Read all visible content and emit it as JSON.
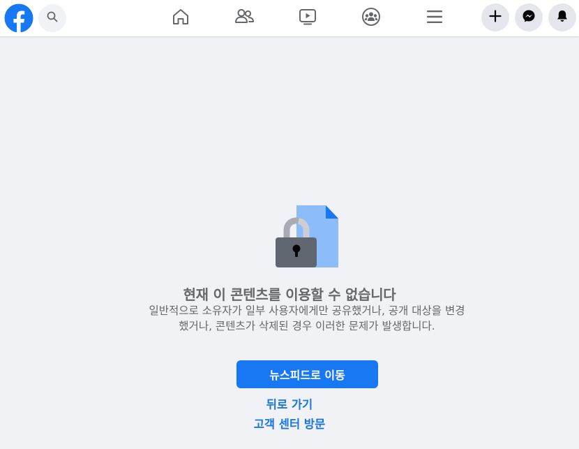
{
  "header": {
    "logo_icon": "facebook-logo-icon",
    "search_icon": "search-icon",
    "nav": [
      {
        "name": "home",
        "icon": "home-icon"
      },
      {
        "name": "friends",
        "icon": "friends-icon"
      },
      {
        "name": "watch",
        "icon": "watch-video-icon"
      },
      {
        "name": "groups",
        "icon": "groups-icon"
      },
      {
        "name": "menu",
        "icon": "hamburger-menu-icon"
      }
    ],
    "actions": [
      {
        "name": "create",
        "icon": "plus-icon"
      },
      {
        "name": "messenger",
        "icon": "messenger-icon"
      },
      {
        "name": "notifications",
        "icon": "bell-icon"
      }
    ]
  },
  "colors": {
    "brand_blue": "#1877f2",
    "link_blue": "#1b74e4",
    "background": "#f0f2f5",
    "secondary_text": "#65676b",
    "lock_body": "#606770",
    "document": "#8cbcf9",
    "document_fold": "#1877f2"
  },
  "main": {
    "illustration_icon": "locked-content-icon",
    "title": "현재 이 콘텐츠를 이용할 수 없습니다",
    "description": "일반적으로 소유자가 일부 사용자에게만 공유했거나, 공개 대상을 변경했거나, 콘텐츠가 삭제된 경우 이러한 문제가 발생합니다.",
    "primary_button": "뉴스피드로 이동",
    "back_link": "뒤로 가기",
    "help_link": "고객 센터 방문"
  }
}
